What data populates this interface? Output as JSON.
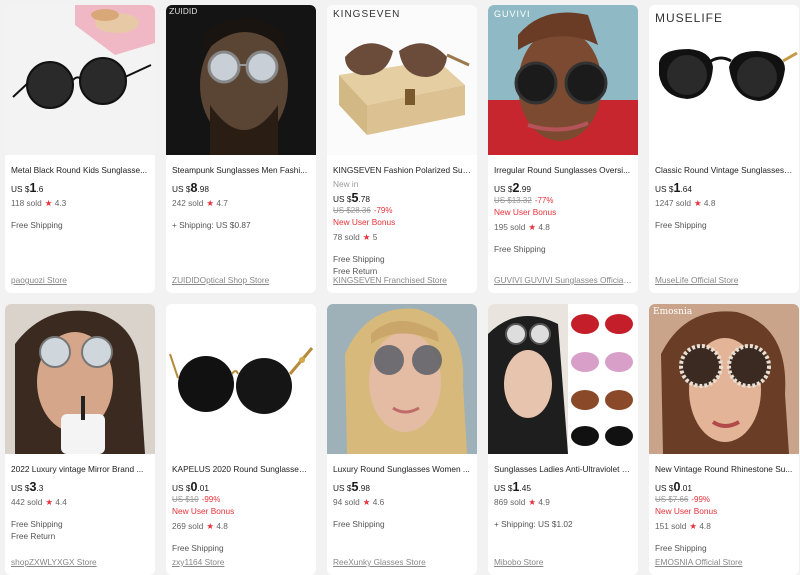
{
  "products": [
    {
      "title": "Metal Black Round Kids Sunglasse...",
      "currency": "US $",
      "price_int": "1",
      "price_dec": ".6",
      "new_in": "",
      "original": "",
      "discount": "",
      "bonus": "",
      "sold": "118 sold",
      "rating": "4.3",
      "shipping": [
        "Free Shipping"
      ],
      "store": "paoguozi Store",
      "brand_text": ""
    },
    {
      "title": "Steampunk Sunglasses Men Fashi...",
      "currency": "US $",
      "price_int": "8",
      "price_dec": ".98",
      "new_in": "",
      "original": "",
      "discount": "",
      "bonus": "",
      "sold": "242 sold",
      "rating": "4.7",
      "shipping": [
        "+ Shipping: US $0.87"
      ],
      "store": "ZUIDIDOptical Shop Store",
      "brand_text": "ZUIDID"
    },
    {
      "title": "KINGSEVEN Fashion Polarized Sun...",
      "currency": "US $",
      "price_int": "5",
      "price_dec": ".78",
      "new_in": "New in",
      "original": "US $28.36",
      "discount": "-79%",
      "bonus": "New User Bonus",
      "sold": "78 sold",
      "rating": "5",
      "shipping": [
        "Free Shipping",
        "Free Return"
      ],
      "store": "KINGSEVEN Franchised Store",
      "brand_text": "KINGSEVEN"
    },
    {
      "title": "Irregular Round Sunglasses Oversi...",
      "currency": "US $",
      "price_int": "2",
      "price_dec": ".99",
      "new_in": "",
      "original": "US $13.32",
      "discount": "-77%",
      "bonus": "New User Bonus",
      "sold": "195 sold",
      "rating": "4.8",
      "shipping": [
        "Free Shipping"
      ],
      "store": "GUVIVI GUVIVI Sunglasses Official ...",
      "brand_text": "GUVIVI"
    },
    {
      "title": "Classic Round Vintage Sunglasses ...",
      "currency": "US $",
      "price_int": "1",
      "price_dec": ".64",
      "new_in": "",
      "original": "",
      "discount": "",
      "bonus": "",
      "sold": "1247 sold",
      "rating": "4.8",
      "shipping": [
        "Free Shipping"
      ],
      "store": "MuseLife Official Store",
      "brand_text": "MUSELIFE"
    },
    {
      "title": "2022 Luxury vintage Mirror Brand ...",
      "currency": "US $",
      "price_int": "3",
      "price_dec": ".3",
      "new_in": "",
      "original": "",
      "discount": "",
      "bonus": "",
      "sold": "442 sold",
      "rating": "4.4",
      "shipping": [
        "Free Shipping",
        "Free Return"
      ],
      "store": "shopZXWLYXGX Store",
      "brand_text": ""
    },
    {
      "title": "KAPELUS 2020 Round Sunglasses ...",
      "currency": "US $",
      "price_int": "0",
      "price_dec": ".01",
      "new_in": "",
      "original": "US $10",
      "discount": "-99%",
      "bonus": "New User Bonus",
      "sold": "269 sold",
      "rating": "4.8",
      "shipping": [
        "Free Shipping"
      ],
      "store": "zxy1164 Store",
      "brand_text": ""
    },
    {
      "title": "Luxury Round Sunglasses Women ...",
      "currency": "US $",
      "price_int": "5",
      "price_dec": ".98",
      "new_in": "",
      "original": "",
      "discount": "",
      "bonus": "",
      "sold": "94 sold",
      "rating": "4.6",
      "shipping": [
        "Free Shipping"
      ],
      "store": "ReeXunky Glasses Store",
      "brand_text": ""
    },
    {
      "title": "Sunglasses Ladies Anti-Ultraviolet J...",
      "currency": "US $",
      "price_int": "1",
      "price_dec": ".45",
      "new_in": "",
      "original": "",
      "discount": "",
      "bonus": "",
      "sold": "869 sold",
      "rating": "4.9",
      "shipping": [
        "+ Shipping: US $1.02"
      ],
      "store": "Mibobo Store",
      "brand_text": ""
    },
    {
      "title": "New Vintage Round Rhinestone Su...",
      "currency": "US $",
      "price_int": "0",
      "price_dec": ".01",
      "new_in": "",
      "original": "US $7.66",
      "discount": "-99%",
      "bonus": "New User Bonus",
      "sold": "151 sold",
      "rating": "4.8",
      "shipping": [
        "Free Shipping"
      ],
      "store": "EMOSNIA Official Store",
      "brand_text": "Emosnia"
    }
  ],
  "colors": {
    "accent": "#e8313a",
    "bg": "#f2f2f2",
    "card": "#ffffff"
  },
  "icons": {
    "rating": "star-icon"
  }
}
